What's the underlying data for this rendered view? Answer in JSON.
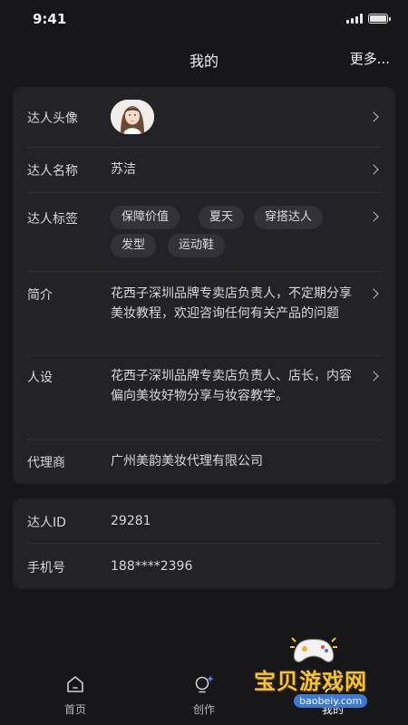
{
  "status": {
    "time": "9:41"
  },
  "header": {
    "title": "我的",
    "more": "更多..."
  },
  "profile": {
    "avatar_label": "达人头像",
    "name_label": "达人名称",
    "name": "苏洁",
    "tags_label": "达人标签",
    "tags": [
      "保障价值",
      "夏天",
      "穿搭达人",
      "发型",
      "运动鞋"
    ],
    "intro_label": "简介",
    "intro": "花西子深圳品牌专卖店负责人，不定期分享美妆教程，欢迎咨询任何有关产品的问题",
    "persona_label": "人设",
    "persona": "花西子深圳品牌专卖店负责人、店长，内容偏向美妆好物分享与妆容教学。",
    "agency_label": "代理商",
    "agency": "广州美韵美妆代理有限公司"
  },
  "account": {
    "id_label": "达人ID",
    "id": "29281",
    "phone_label": "手机号",
    "phone": "188****2396"
  },
  "tabs": [
    {
      "label": "首页",
      "icon": "home-icon"
    },
    {
      "label": "创作",
      "icon": "lightbulb-sparkle-icon"
    },
    {
      "label": "我的",
      "icon": "profile-icon"
    }
  ],
  "watermark": {
    "title": "宝贝游戏网",
    "url": "baobeiy.com"
  }
}
